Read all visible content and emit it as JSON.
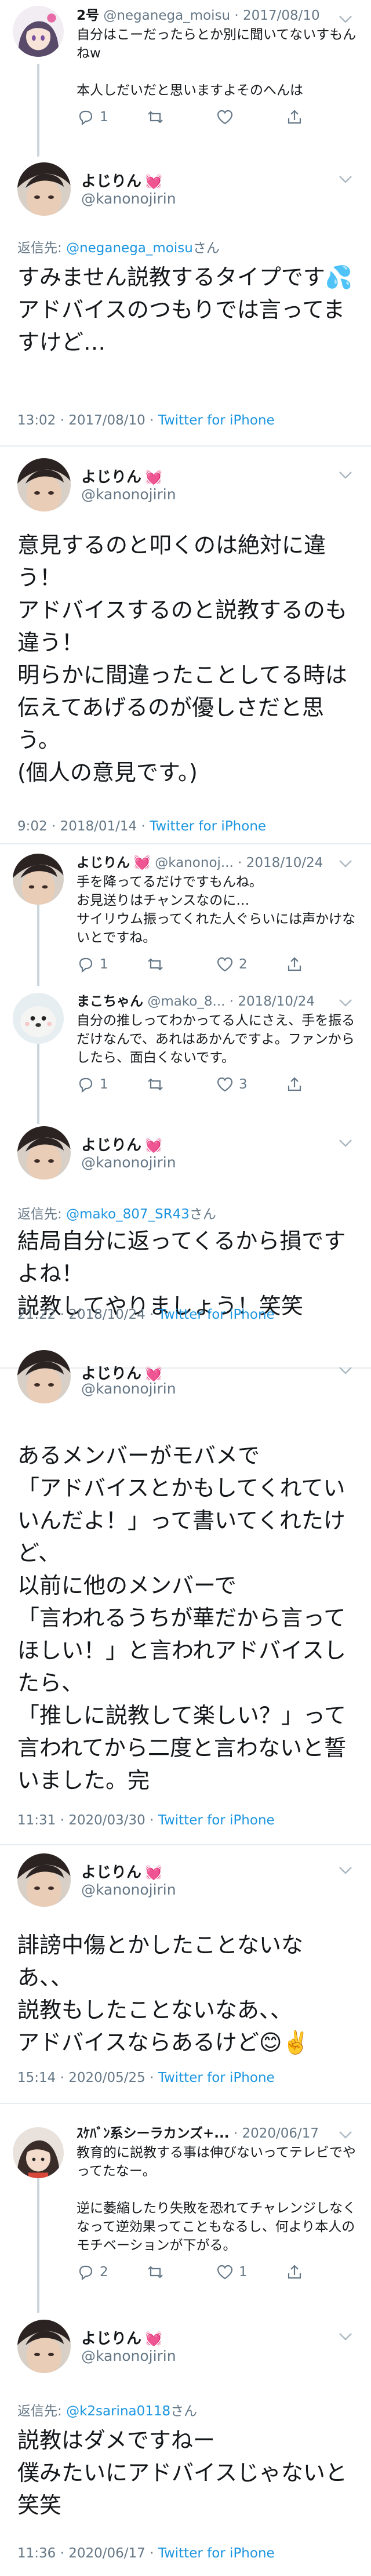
{
  "colors": {
    "link": "#1b95e0",
    "muted": "#657786",
    "heart": "#e0245e"
  },
  "icons": [
    "reply-icon",
    "retweet-icon",
    "like-icon",
    "share-icon",
    "chevron-down-icon"
  ],
  "t1": {
    "name": "2号",
    "handle": "@neganega_moisu",
    "date": "2017/08/10",
    "text": "自分はこーだったらとか別に聞いてないすもんねw\n\n本人しだいだと思いますよそのへんは",
    "reply_count": "1",
    "retweet_count": "",
    "like_count": ""
  },
  "f1": {
    "name": "よじりん",
    "handle": "@kanonojirin",
    "reply_prefix": "返信先: ",
    "reply_to": "@neganega_moisu",
    "reply_suffix": "さん",
    "text": "すみません説教するタイプです💦\nアドバイスのつもりでは言ってますけど…",
    "time": "13:02 · 2017/08/10 · ",
    "source": "Twitter for iPhone"
  },
  "f2": {
    "name": "よじりん",
    "handle": "@kanonojirin",
    "text": "意見するのと叩くのは絶対に違う！\nアドバイスするのと説教するのも違う！\n明らかに間違ったことしてる時は伝えてあげるのが優しさだと思う。\n(個人の意見です。)",
    "time": "9:02 · 2018/01/14 · ",
    "source": "Twitter for iPhone"
  },
  "t2": {
    "name": "よじりん",
    "handle": "@kanonoj...",
    "date": "2018/10/24",
    "text": "手を降ってるだけですもんね。\nお見送りはチャンスなのに…\nサイリウム振ってくれた人ぐらいには声かけないとですね。",
    "reply_count": "1",
    "retweet_count": "",
    "like_count": "2"
  },
  "t3": {
    "name": "まこちゃん",
    "handle": "@mako_8...",
    "date": "2018/10/24",
    "text": "自分の推しってわかってる人にさえ、手を振るだけなんで、あれはあかんですよ。ファンからしたら、面白くないです。",
    "reply_count": "1",
    "retweet_count": "",
    "like_count": "3"
  },
  "f3": {
    "name": "よじりん",
    "handle": "@kanonojirin",
    "reply_prefix": "返信先: ",
    "reply_to": "@mako_807_SR43",
    "reply_suffix": "さん",
    "text": "結局自分に返ってくるから損ですよね！\n説教してやりましょう！笑笑",
    "time": "21:22 · 2018/10/24 · ",
    "source": "Twitter for iPhone"
  },
  "f4": {
    "name": "よじりん",
    "handle": "@kanonojirin",
    "text": "あるメンバーがモバメで\n「アドバイスとかもしてくれていいんだよ！」って書いてくれたけど、\n以前に他のメンバーで\n「言われるうちが華だから言ってほしい！」と言われアドバイスしたら、\n「推しに説教して楽しい？」って言われてから二度と言わないと誓いました。完",
    "time": "11:31 · 2020/03/30 · ",
    "source": "Twitter for iPhone"
  },
  "f5": {
    "name": "よじりん",
    "handle": "@kanonojirin",
    "text": "誹謗中傷とかしたことないなあ、、\n説教もしたことないなあ、、\nアドバイスならあるけど😊✌️",
    "time": "15:14 · 2020/05/25 · ",
    "source": "Twitter for iPhone"
  },
  "t4": {
    "name": "ｽｹﾊﾞﾝ系シーラカンズ+...",
    "handle": "",
    "date": "2020/06/17",
    "text": "教育的に説教する事は伸びないってテレビでやってたなー。\n\n逆に萎縮したり失敗を恐れてチャレンジしなくなって逆効果ってこともなるし、何より本人のモチベーションが下がる。",
    "reply_count": "2",
    "retweet_count": "",
    "like_count": "1"
  },
  "f6": {
    "name": "よじりん",
    "handle": "@kanonojirin",
    "reply_prefix": "返信先: ",
    "reply_to": "@k2sarina0118",
    "reply_suffix": "さん",
    "text": "説教はダメですねー\n僕みたいにアドバイスじゃないと笑笑",
    "time": "11:36 · 2020/06/17 · ",
    "source": "Twitter for iPhone"
  }
}
